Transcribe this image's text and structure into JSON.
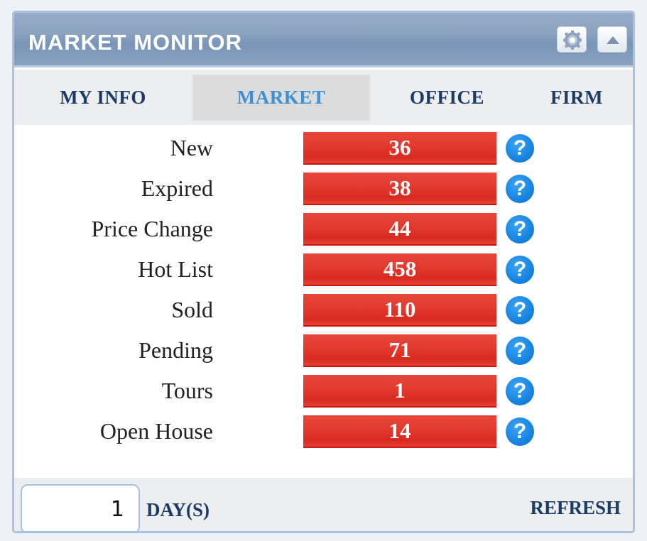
{
  "widget": {
    "title": "MARKET MONITOR",
    "gear_icon": "gear-icon",
    "collapse_icon": "triangle-up-icon"
  },
  "tabs": [
    {
      "label": "MY INFO",
      "active": false
    },
    {
      "label": "MARKET",
      "active": true
    },
    {
      "label": "OFFICE",
      "active": false
    },
    {
      "label": "FIRM",
      "active": false
    }
  ],
  "stats": [
    {
      "label": "New",
      "value": "36"
    },
    {
      "label": "Expired",
      "value": "38"
    },
    {
      "label": "Price Change",
      "value": "44"
    },
    {
      "label": "Hot List",
      "value": "458"
    },
    {
      "label": "Sold",
      "value": "110"
    },
    {
      "label": "Pending",
      "value": "71"
    },
    {
      "label": "Tours",
      "value": "1"
    },
    {
      "label": "Open House",
      "value": "14"
    }
  ],
  "help_glyph": "?",
  "footer": {
    "days_value": "1",
    "days_label": "DAY(S)",
    "refresh_label": "REFRESH"
  },
  "colors": {
    "bar": "#e23a2f",
    "accent": "#3d8fd6",
    "tab_text": "#1c3c66",
    "help": "#1784e0"
  }
}
